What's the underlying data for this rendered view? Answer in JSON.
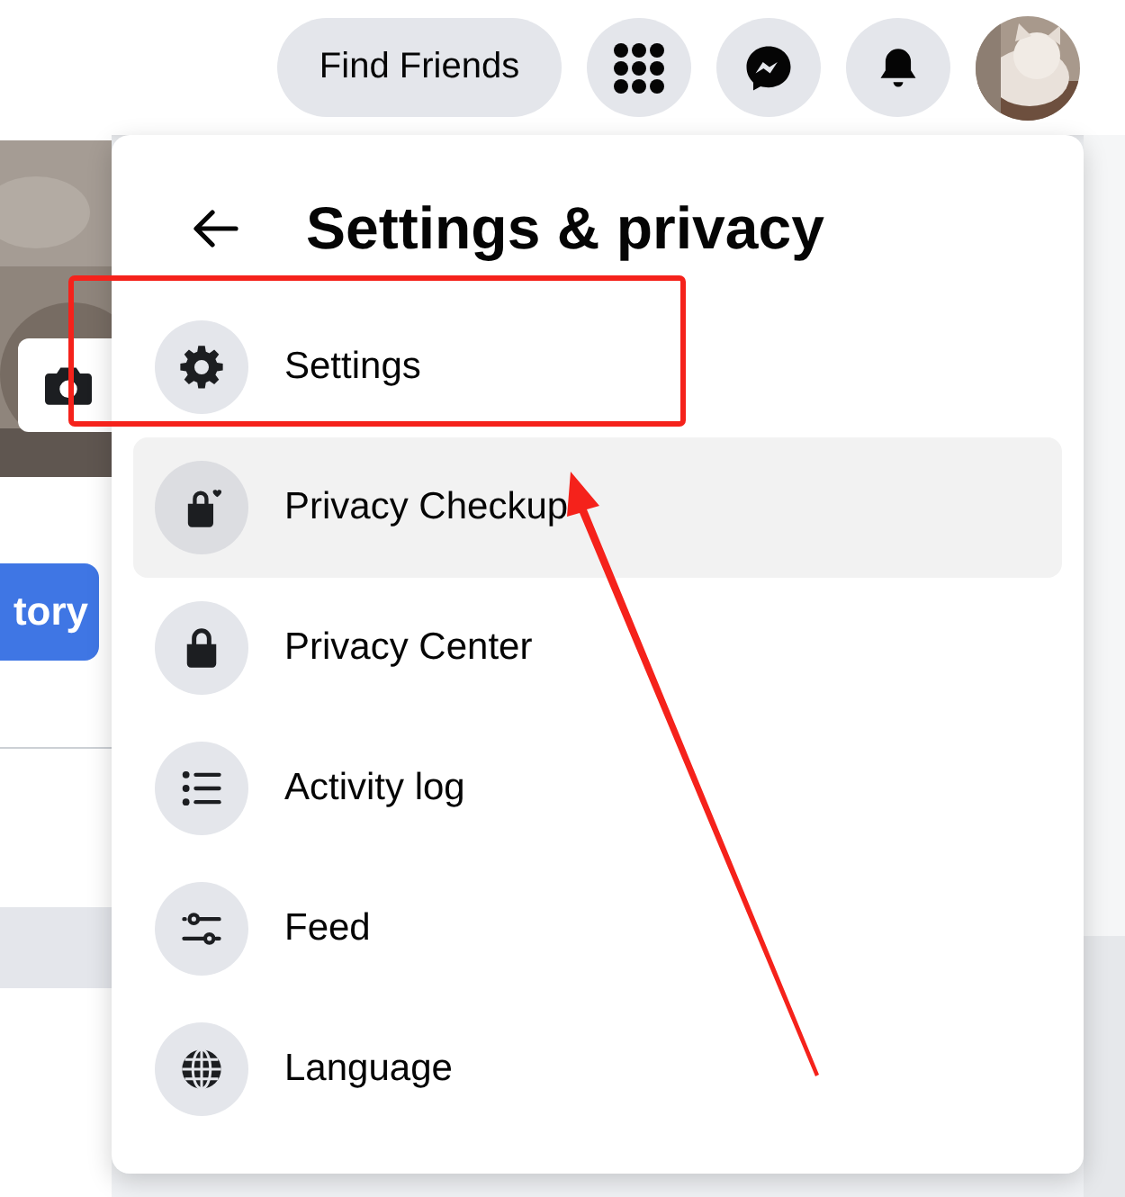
{
  "header": {
    "find_friends": "Find Friends"
  },
  "profile": {
    "story_button": "tory"
  },
  "menu": {
    "title": "Settings & privacy",
    "items": [
      {
        "label": "Settings",
        "highlighted": false
      },
      {
        "label": "Privacy Checkup",
        "highlighted": true
      },
      {
        "label": "Privacy Center",
        "highlighted": false
      },
      {
        "label": "Activity log",
        "highlighted": false
      },
      {
        "label": "Feed",
        "highlighted": false
      },
      {
        "label": "Language",
        "highlighted": false
      }
    ]
  }
}
